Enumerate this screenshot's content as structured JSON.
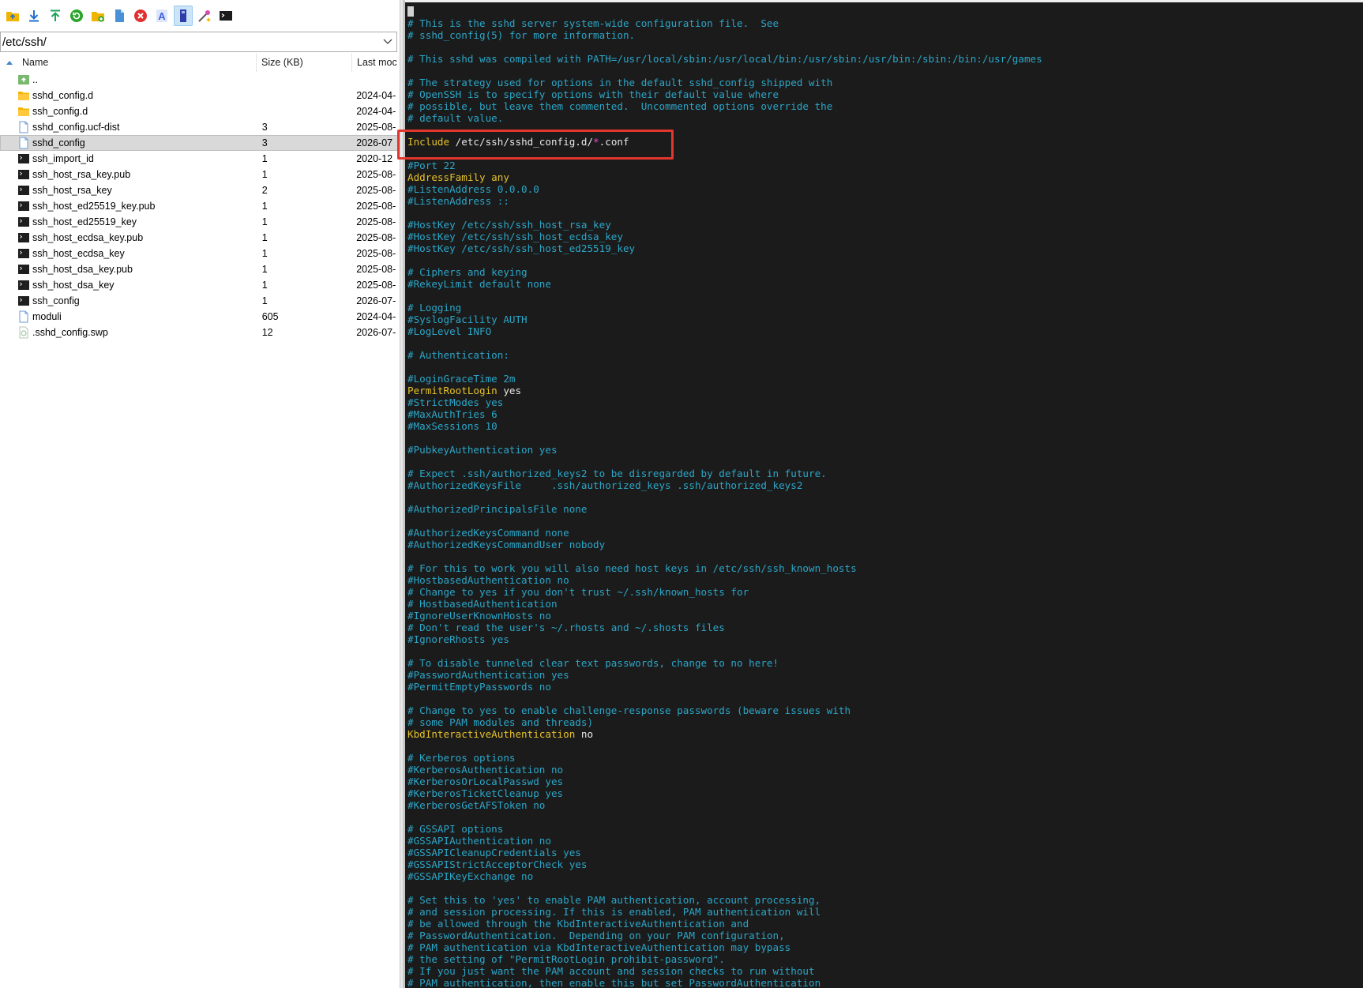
{
  "toolbar": {
    "buttons": [
      {
        "icon": "parent-folder-icon",
        "color": "#f0b400"
      },
      {
        "icon": "download-icon",
        "color": "#1f6fd1"
      },
      {
        "icon": "upload-icon",
        "color": "#1aa35a"
      },
      {
        "icon": "refresh-icon",
        "color": "#2aa52a"
      },
      {
        "icon": "new-folder-icon",
        "color": "#f0b400"
      },
      {
        "icon": "new-file-icon",
        "color": "#4a90d9"
      },
      {
        "icon": "delete-icon",
        "color": "#e03030"
      },
      {
        "icon": "rename-icon",
        "color": "#3b5fd9"
      },
      {
        "icon": "properties-icon",
        "color": "#2d3ea8"
      },
      {
        "icon": "edit-icon",
        "color": "#d94ab0"
      },
      {
        "icon": "terminal-icon",
        "color": "#1b1b1b"
      }
    ]
  },
  "path": "/etc/ssh/",
  "file_columns": {
    "name": "Name",
    "size": "Size (KB)",
    "modified": "Last moc"
  },
  "files": [
    {
      "name": "..",
      "size": "",
      "modified": "",
      "icon": "parent-dir-icon"
    },
    {
      "name": "sshd_config.d",
      "size": "",
      "modified": "2024-04-",
      "icon": "folder-icon"
    },
    {
      "name": "ssh_config.d",
      "size": "",
      "modified": "2024-04-",
      "icon": "folder-icon"
    },
    {
      "name": "sshd_config.ucf-dist",
      "size": "3",
      "modified": "2025-08-",
      "icon": "document-icon"
    },
    {
      "name": "sshd_config",
      "size": "3",
      "modified": "2026-07",
      "icon": "document-icon"
    },
    {
      "name": "ssh_import_id",
      "size": "1",
      "modified": "2020-12",
      "icon": "terminal-file-icon"
    },
    {
      "name": "ssh_host_rsa_key.pub",
      "size": "1",
      "modified": "2025-08-",
      "icon": "terminal-file-icon"
    },
    {
      "name": "ssh_host_rsa_key",
      "size": "2",
      "modified": "2025-08-",
      "icon": "terminal-file-icon"
    },
    {
      "name": "ssh_host_ed25519_key.pub",
      "size": "1",
      "modified": "2025-08-",
      "icon": "terminal-file-icon"
    },
    {
      "name": "ssh_host_ed25519_key",
      "size": "1",
      "modified": "2025-08-",
      "icon": "terminal-file-icon"
    },
    {
      "name": "ssh_host_ecdsa_key.pub",
      "size": "1",
      "modified": "2025-08-",
      "icon": "terminal-file-icon"
    },
    {
      "name": "ssh_host_ecdsa_key",
      "size": "1",
      "modified": "2025-08-",
      "icon": "terminal-file-icon"
    },
    {
      "name": "ssh_host_dsa_key.pub",
      "size": "1",
      "modified": "2025-08-",
      "icon": "terminal-file-icon"
    },
    {
      "name": "ssh_host_dsa_key",
      "size": "1",
      "modified": "2025-08-",
      "icon": "terminal-file-icon"
    },
    {
      "name": "ssh_config",
      "size": "1",
      "modified": "2026-07-",
      "icon": "terminal-file-icon"
    },
    {
      "name": "moduli",
      "size": "605",
      "modified": "2024-04-",
      "icon": "document-icon"
    },
    {
      "name": ".sshd_config.swp",
      "size": "12",
      "modified": "2026-07-",
      "icon": "swap-file-icon"
    }
  ],
  "selected_file": "sshd_config",
  "editor": {
    "lines": [
      [
        {
          "t": "# This is the sshd server system-wide configuration file.  See",
          "c": "comment"
        }
      ],
      [
        {
          "t": "# sshd_config(5) for more information.",
          "c": "comment"
        }
      ],
      [],
      [
        {
          "t": "# This sshd was compiled with PATH=/usr/local/sbin:/usr/local/bin:/usr/sbin:/usr/bin:/sbin:/bin:/usr/games",
          "c": "comment"
        }
      ],
      [],
      [
        {
          "t": "# The strategy used for options in the default sshd_config shipped with",
          "c": "comment"
        }
      ],
      [
        {
          "t": "# OpenSSH is to specify options with their default value where",
          "c": "comment"
        }
      ],
      [
        {
          "t": "# possible, but leave them commented.  Uncommented options override the",
          "c": "comment"
        }
      ],
      [
        {
          "t": "# default value.",
          "c": "comment"
        }
      ],
      [],
      [
        {
          "t": "Include",
          "c": "key"
        },
        {
          "t": " /etc/ssh/sshd_config.d/",
          "c": "val"
        },
        {
          "t": "*",
          "c": "star"
        },
        {
          "t": ".conf",
          "c": "val"
        }
      ],
      [],
      [
        {
          "t": "#Port 22",
          "c": "comment"
        }
      ],
      [
        {
          "t": "AddressFamily",
          "c": "key"
        },
        {
          "t": " any",
          "c": "key"
        }
      ],
      [
        {
          "t": "#ListenAddress 0.0.0.0",
          "c": "comment"
        }
      ],
      [
        {
          "t": "#ListenAddress ::",
          "c": "comment"
        }
      ],
      [],
      [
        {
          "t": "#HostKey /etc/ssh/ssh_host_rsa_key",
          "c": "comment"
        }
      ],
      [
        {
          "t": "#HostKey /etc/ssh/ssh_host_ecdsa_key",
          "c": "comment"
        }
      ],
      [
        {
          "t": "#HostKey /etc/ssh/ssh_host_ed25519_key",
          "c": "comment"
        }
      ],
      [],
      [
        {
          "t": "# Ciphers and keying",
          "c": "comment"
        }
      ],
      [
        {
          "t": "#RekeyLimit default none",
          "c": "comment"
        }
      ],
      [],
      [
        {
          "t": "# Logging",
          "c": "comment"
        }
      ],
      [
        {
          "t": "#SyslogFacility AUTH",
          "c": "comment"
        }
      ],
      [
        {
          "t": "#LogLevel INFO",
          "c": "comment"
        }
      ],
      [],
      [
        {
          "t": "# Authentication:",
          "c": "comment"
        }
      ],
      [],
      [
        {
          "t": "#LoginGraceTime 2m",
          "c": "comment"
        }
      ],
      [
        {
          "t": "PermitRootLogin",
          "c": "key"
        },
        {
          "t": " yes",
          "c": "val"
        }
      ],
      [
        {
          "t": "#StrictModes yes",
          "c": "comment"
        }
      ],
      [
        {
          "t": "#MaxAuthTries 6",
          "c": "comment"
        }
      ],
      [
        {
          "t": "#MaxSessions 10",
          "c": "comment"
        }
      ],
      [],
      [
        {
          "t": "#PubkeyAuthentication yes",
          "c": "comment"
        }
      ],
      [],
      [
        {
          "t": "# Expect .ssh/authorized_keys2 to be disregarded by default in future.",
          "c": "comment"
        }
      ],
      [
        {
          "t": "#AuthorizedKeysFile     .ssh/authorized_keys .ssh/authorized_keys2",
          "c": "comment"
        }
      ],
      [],
      [
        {
          "t": "#AuthorizedPrincipalsFile none",
          "c": "comment"
        }
      ],
      [],
      [
        {
          "t": "#AuthorizedKeysCommand none",
          "c": "comment"
        }
      ],
      [
        {
          "t": "#AuthorizedKeysCommandUser nobody",
          "c": "comment"
        }
      ],
      [],
      [
        {
          "t": "# For this to work you will also need host keys in /etc/ssh/ssh_known_hosts",
          "c": "comment"
        }
      ],
      [
        {
          "t": "#HostbasedAuthentication no",
          "c": "comment"
        }
      ],
      [
        {
          "t": "# Change to yes if you don't trust ~/.ssh/known_hosts for",
          "c": "comment"
        }
      ],
      [
        {
          "t": "# HostbasedAuthentication",
          "c": "comment"
        }
      ],
      [
        {
          "t": "#IgnoreUserKnownHosts no",
          "c": "comment"
        }
      ],
      [
        {
          "t": "# Don't read the user's ~/.rhosts and ~/.shosts files",
          "c": "comment"
        }
      ],
      [
        {
          "t": "#IgnoreRhosts yes",
          "c": "comment"
        }
      ],
      [],
      [
        {
          "t": "# To disable tunneled clear text passwords, change to no here!",
          "c": "comment"
        }
      ],
      [
        {
          "t": "#PasswordAuthentication yes",
          "c": "comment"
        }
      ],
      [
        {
          "t": "#PermitEmptyPasswords no",
          "c": "comment"
        }
      ],
      [],
      [
        {
          "t": "# Change to yes to enable challenge-response passwords (beware issues with",
          "c": "comment"
        }
      ],
      [
        {
          "t": "# some PAM modules and threads)",
          "c": "comment"
        }
      ],
      [
        {
          "t": "KbdInteractiveAuthentication",
          "c": "key"
        },
        {
          "t": " no",
          "c": "val"
        }
      ],
      [],
      [
        {
          "t": "# Kerberos options",
          "c": "comment"
        }
      ],
      [
        {
          "t": "#KerberosAuthentication no",
          "c": "comment"
        }
      ],
      [
        {
          "t": "#KerberosOrLocalPasswd yes",
          "c": "comment"
        }
      ],
      [
        {
          "t": "#KerberosTicketCleanup yes",
          "c": "comment"
        }
      ],
      [
        {
          "t": "#KerberosGetAFSToken no",
          "c": "comment"
        }
      ],
      [],
      [
        {
          "t": "# GSSAPI options",
          "c": "comment"
        }
      ],
      [
        {
          "t": "#GSSAPIAuthentication no",
          "c": "comment"
        }
      ],
      [
        {
          "t": "#GSSAPICleanupCredentials yes",
          "c": "comment"
        }
      ],
      [
        {
          "t": "#GSSAPIStrictAcceptorCheck yes",
          "c": "comment"
        }
      ],
      [
        {
          "t": "#GSSAPIKeyExchange no",
          "c": "comment"
        }
      ],
      [],
      [
        {
          "t": "# Set this to 'yes' to enable PAM authentication, account processing,",
          "c": "comment"
        }
      ],
      [
        {
          "t": "# and session processing. If this is enabled, PAM authentication will",
          "c": "comment"
        }
      ],
      [
        {
          "t": "# be allowed through the KbdInteractiveAuthentication and",
          "c": "comment"
        }
      ],
      [
        {
          "t": "# PasswordAuthentication.  Depending on your PAM configuration,",
          "c": "comment"
        }
      ],
      [
        {
          "t": "# PAM authentication via KbdInteractiveAuthentication may bypass",
          "c": "comment"
        }
      ],
      [
        {
          "t": "# the setting of \"PermitRootLogin prohibit-password\".",
          "c": "comment"
        }
      ],
      [
        {
          "t": "# If you just want the PAM account and session checks to run without",
          "c": "comment"
        }
      ],
      [
        {
          "t": "# PAM authentication, then enable this but set PasswordAuthentication",
          "c": "comment"
        }
      ]
    ]
  },
  "colors": {
    "terminal_bg": "#1b1b1b",
    "comment": "#2ba6c8",
    "keyword": "#e6c229",
    "value": "#e8e8e8",
    "glob": "#e84fd6",
    "highlight_box": "#e2372f",
    "selected_row": "#d9d9d9"
  }
}
